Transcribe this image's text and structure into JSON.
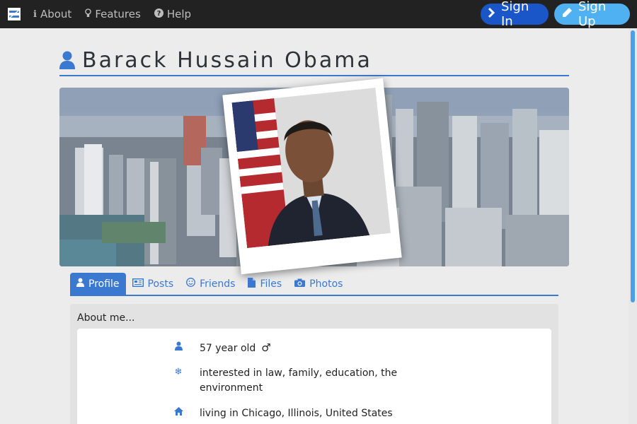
{
  "navbar": {
    "logo_icon": "brand-logo",
    "links": [
      {
        "label": "About",
        "icon": "info-icon"
      },
      {
        "label": "Features",
        "icon": "lightbulb-icon"
      },
      {
        "label": "Help",
        "icon": "question-circle-icon"
      }
    ],
    "signin_label": "Sign In",
    "signup_label": "Sign Up"
  },
  "profile": {
    "name": "Barack Hussain Obama",
    "name_icon": "user-icon"
  },
  "tabs": [
    {
      "label": "Profile",
      "icon": "user-icon",
      "active": true
    },
    {
      "label": "Posts",
      "icon": "newspaper-icon",
      "active": false
    },
    {
      "label": "Friends",
      "icon": "smile-icon",
      "active": false
    },
    {
      "label": "Files",
      "icon": "file-icon",
      "active": false
    },
    {
      "label": "Photos",
      "icon": "camera-icon",
      "active": false
    }
  ],
  "about": {
    "heading": "About me...",
    "items": [
      {
        "icon": "user-icon",
        "text": "57 year old",
        "gender_symbol": "♂"
      },
      {
        "icon": "snowflake-icon",
        "text": "interested in law, family, education, the environment"
      },
      {
        "icon": "home-icon",
        "text": "living in Chicago, Illinois, United States"
      }
    ]
  },
  "colors": {
    "navbar_bg": "#222222",
    "accent": "#3b78d0",
    "signin_bg": "#1a56c7",
    "signup_bg": "#4fb1f2"
  }
}
